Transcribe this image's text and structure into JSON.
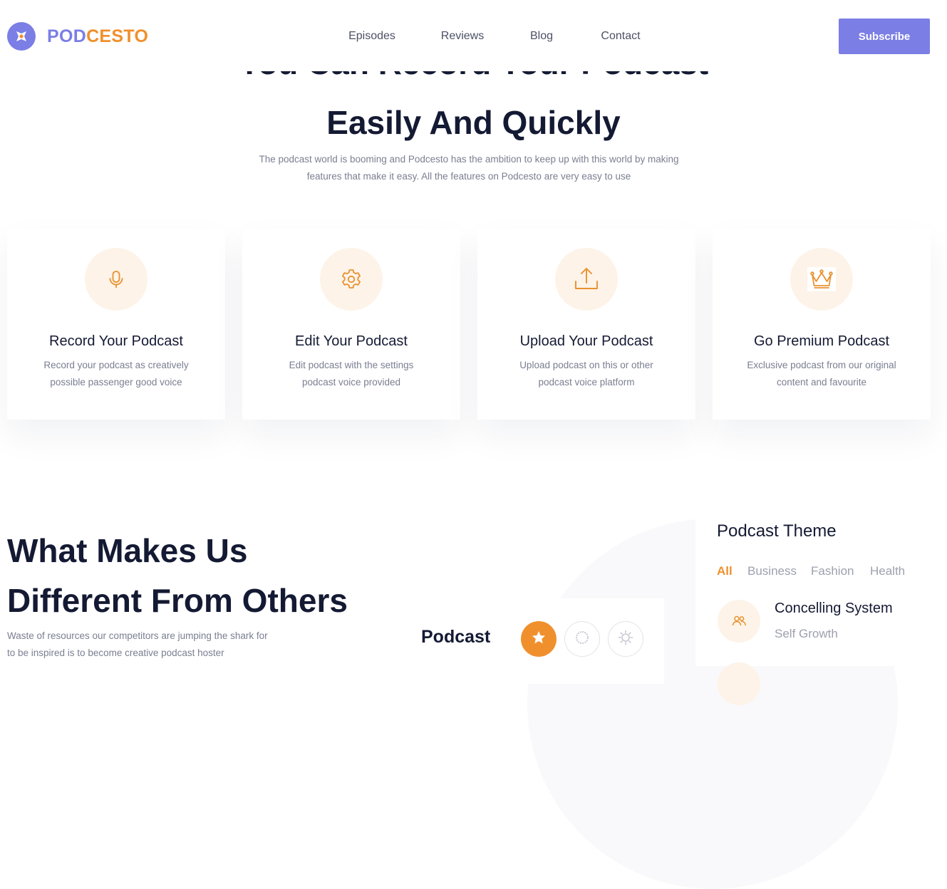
{
  "brand": {
    "logo_part1": "POD",
    "logo_part2": "CESTO",
    "primary_color": "#7b7ee5",
    "accent_color": "#f0902d"
  },
  "nav": {
    "items": [
      {
        "label": "Episodes"
      },
      {
        "label": "Reviews"
      },
      {
        "label": "Blog"
      },
      {
        "label": "Contact"
      }
    ],
    "subscribe_label": "Subscribe"
  },
  "hero": {
    "title_line1": "You Can Record Your Podcast",
    "title_line2": "Easily And Quickly",
    "description_line1": "The podcast world is booming and Podcesto has the ambition to keep up with this world by making",
    "description_line2": "features that make it easy. All the features on Podcesto are very easy to use"
  },
  "features": [
    {
      "icon": "microphone-icon",
      "title": "Record Your Podcast",
      "desc_line1": "Record your podcast as creatively",
      "desc_line2": "possible passenger good voice"
    },
    {
      "icon": "gear-icon",
      "title": "Edit Your Podcast",
      "desc_line1": "Edit podcast with the settings",
      "desc_line2": "podcast voice provided"
    },
    {
      "icon": "upload-icon",
      "title": "Upload Your Podcast",
      "desc_line1": "Upload podcast on this or other",
      "desc_line2": "podcast voice platform"
    },
    {
      "icon": "crown-icon",
      "title": "Go Premium Podcast",
      "desc_line1": "Exclusive podcast from our original",
      "desc_line2": "content and favourite"
    }
  ],
  "difference": {
    "title_line1": "What Makes Us",
    "title_line2": "Different From Others",
    "desc_line1": "Waste of resources our competitors are jumping the shark for",
    "desc_line2": "to be inspired is to become creative podcast hoster"
  },
  "podcast_widget": {
    "label": "Podcast",
    "buttons": [
      {
        "icon": "star-icon",
        "active": true
      },
      {
        "icon": "circle-icon",
        "active": false
      },
      {
        "icon": "sun-icon",
        "active": false
      }
    ]
  },
  "theme": {
    "title": "Podcast Theme",
    "tabs": [
      {
        "label": "All",
        "active": true
      },
      {
        "label": "Business",
        "active": false
      },
      {
        "label": "Fashion",
        "active": false
      },
      {
        "label": "Health",
        "active": false
      }
    ],
    "items": [
      {
        "icon": "users-icon",
        "title": "Concelling System",
        "subtitle": "Self Growth"
      }
    ]
  }
}
